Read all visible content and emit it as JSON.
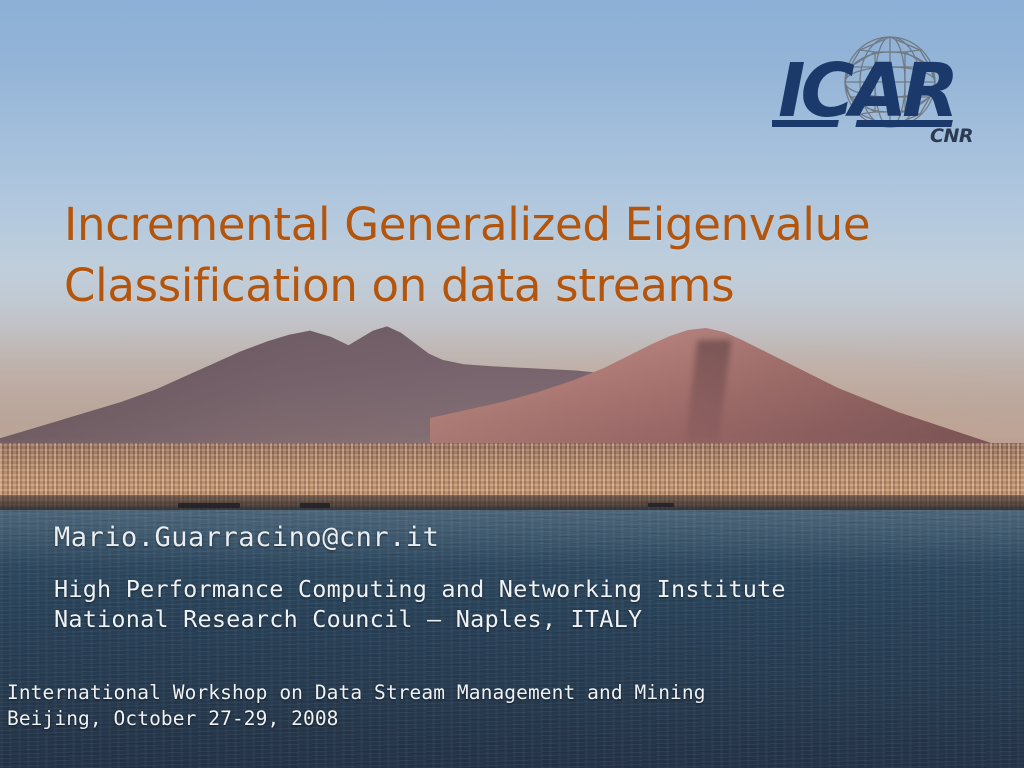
{
  "slide": {
    "title": "Incremental Generalized Eigenvalue\nClassification on data streams",
    "title_color": "#b3550d",
    "author_email": "Mario.Guarracino@cnr.it",
    "affiliation": "High Performance Computing and Networking Institute\nNational Research Council – Naples, ITALY",
    "footer": "International Workshop on Data Stream Management and Mining\nBeijing, October 27-29, 2008",
    "text_color": "#eef2f5"
  },
  "logo": {
    "wordmark": "ICAR",
    "subtext": "CNR",
    "mark_color": "#1b3a6b",
    "globe_color": "#6f7680"
  },
  "background": {
    "scene": "mount-vesuvius-bay-of-naples-photo",
    "sky_top_color": "#8cb0d6",
    "sky_horizon_color": "#b89a8c",
    "city_color": "#c29470",
    "sea_top_color": "#3c5469",
    "sea_bottom_color": "#253449"
  }
}
